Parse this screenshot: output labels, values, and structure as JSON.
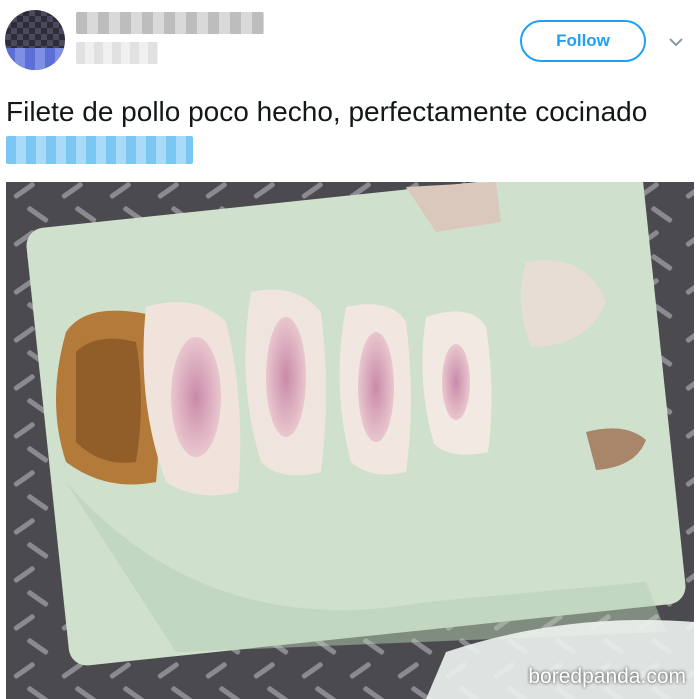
{
  "header": {
    "follow_label": "Follow",
    "caret_icon": "chevron-down-icon"
  },
  "tweet": {
    "text": "Filete de pollo poco hecho, perfectamente cocinado"
  },
  "watermark": {
    "text": "boredpanda.com"
  },
  "colors": {
    "accent": "#1da1f2",
    "text": "#14171a",
    "board": "#c9dcc7"
  }
}
